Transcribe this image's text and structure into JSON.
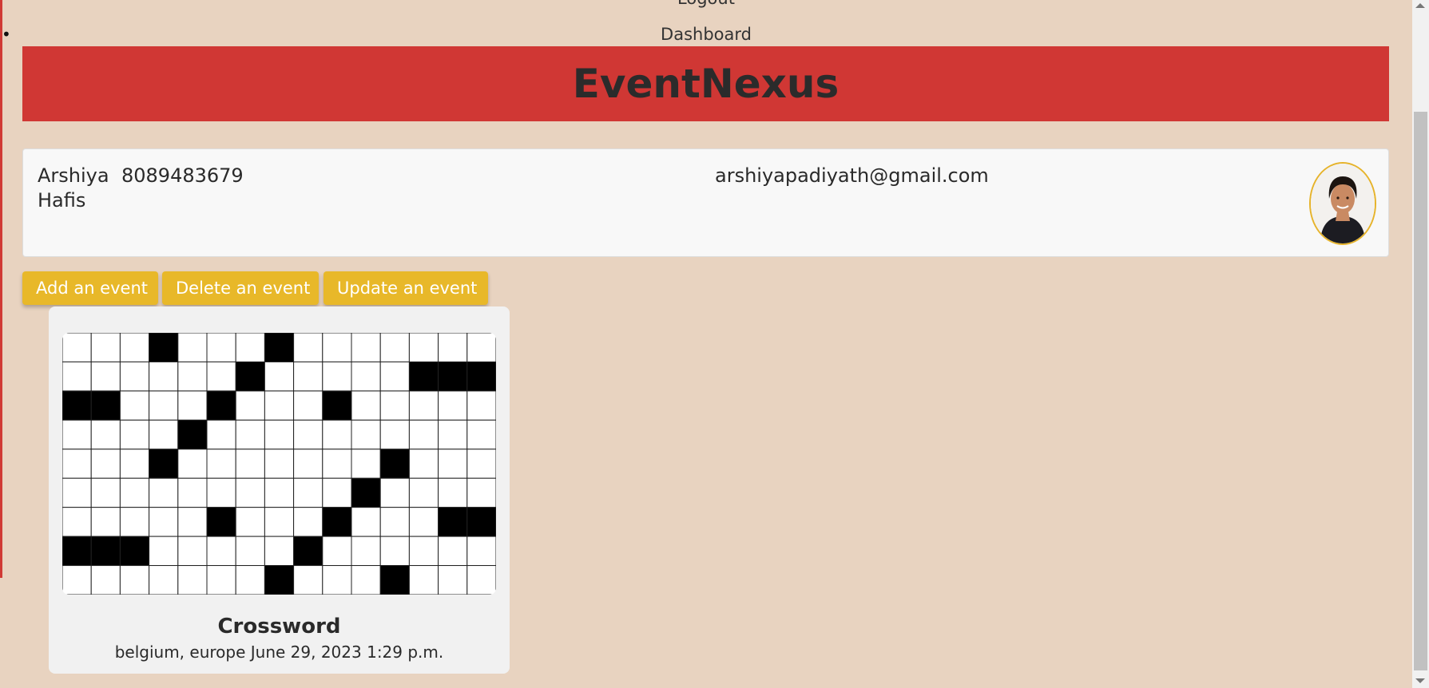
{
  "nav": {
    "items": [
      {
        "label": "Logout"
      },
      {
        "label": "Dashboard"
      }
    ]
  },
  "header": {
    "title": "EventNexus"
  },
  "profile": {
    "name": "Arshiya Hafis",
    "phone": "8089483679",
    "email": "arshiyapadiyath@gmail.com",
    "avatar_icon": "user-photo"
  },
  "actions": {
    "add_label": "Add an event",
    "delete_label": "Delete an event",
    "update_label": "Update an event"
  },
  "events": [
    {
      "title": "Crossword",
      "meta": "belgium, europe June 29, 2023 1:29 p.m.",
      "image_icon": "crossword-image"
    }
  ],
  "colors": {
    "page_bg": "#e8d3c0",
    "header_bg": "#d03734",
    "button_bg": "#e8b829",
    "card_bg": "#f1f1f1",
    "profile_bg": "#f8f8f8"
  }
}
